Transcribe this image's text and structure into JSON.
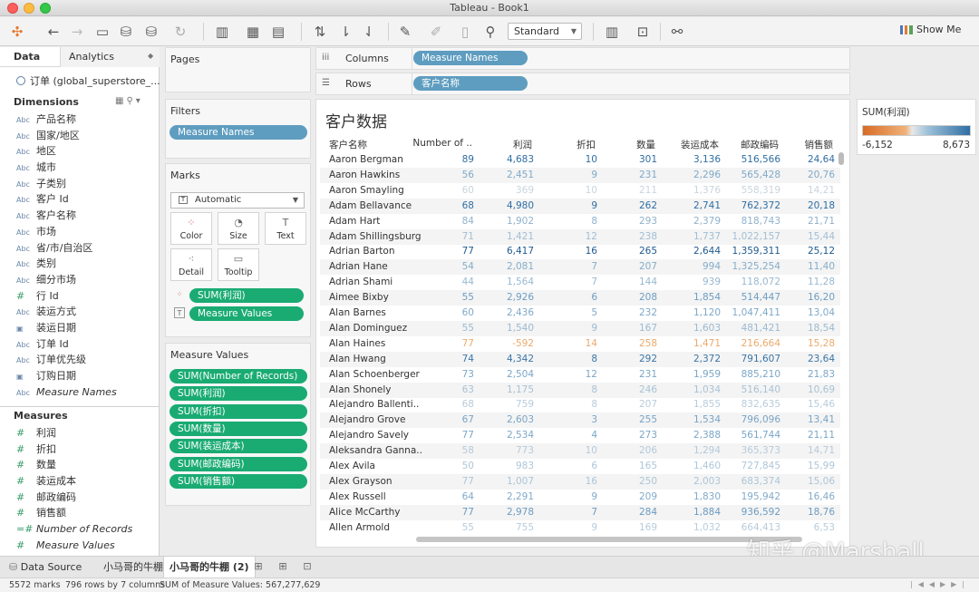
{
  "window": {
    "title": "Tableau - Book1"
  },
  "toolbar": {
    "icons": [
      "tableau-logo-icon",
      "back-icon",
      "forward-icon",
      "save-icon",
      "new-datasource-icon",
      "datasource-icon",
      "refresh-icon",
      "new-sheet-icon",
      "duplicate-sheet-icon",
      "clear-sheet-icon",
      "swap-icon",
      "sort-asc-icon",
      "sort-desc-icon",
      "highlight-icon",
      "annotate-icon",
      "fit-icon",
      "pin-icon",
      "chart-size-icon",
      "presentation-icon",
      "share-icon"
    ],
    "fit_select": "Standard",
    "show_me": "Show Me"
  },
  "left_pane": {
    "tab_data": "Data",
    "tab_analytics": "Analytics",
    "datasource": "订单 (global_superstore_...",
    "dimensions_title": "Dimensions",
    "dimensions": [
      {
        "type": "Abc",
        "name": "产品名称"
      },
      {
        "type": "Abc",
        "name": "国家/地区"
      },
      {
        "type": "Abc",
        "name": "地区"
      },
      {
        "type": "Abc",
        "name": "城市"
      },
      {
        "type": "Abc",
        "name": "子类别"
      },
      {
        "type": "Abc",
        "name": "客户 Id"
      },
      {
        "type": "Abc",
        "name": "客户名称"
      },
      {
        "type": "Abc",
        "name": "市场"
      },
      {
        "type": "Abc",
        "name": "省/市/自治区"
      },
      {
        "type": "Abc",
        "name": "类别"
      },
      {
        "type": "Abc",
        "name": "细分市场"
      },
      {
        "type": "#",
        "name": "行 Id"
      },
      {
        "type": "Abc",
        "name": "装运方式"
      },
      {
        "type": "▣",
        "name": "装运日期"
      },
      {
        "type": "Abc",
        "name": "订单 Id"
      },
      {
        "type": "Abc",
        "name": "订单优先级"
      },
      {
        "type": "▣",
        "name": "订购日期"
      },
      {
        "type": "Abc",
        "name": "Measure Names"
      }
    ],
    "measures_title": "Measures",
    "measures": [
      {
        "type": "#",
        "name": "利润"
      },
      {
        "type": "#",
        "name": "折扣"
      },
      {
        "type": "#",
        "name": "数量"
      },
      {
        "type": "#",
        "name": "装运成本"
      },
      {
        "type": "#",
        "name": "邮政编码"
      },
      {
        "type": "#",
        "name": "销售额"
      },
      {
        "type": "=#",
        "name": "Number of Records"
      },
      {
        "type": "#",
        "name": "Measure Values"
      }
    ]
  },
  "pages": {
    "title": "Pages"
  },
  "filters": {
    "title": "Filters",
    "pills": [
      "Measure Names"
    ]
  },
  "marks": {
    "title": "Marks",
    "type": "Automatic",
    "buttons": [
      {
        "label": "Color",
        "icon": "⁘"
      },
      {
        "label": "Size",
        "icon": "◔"
      },
      {
        "label": "Text",
        "icon": "T"
      },
      {
        "label": "Detail",
        "icon": "⁖"
      },
      {
        "label": "Tooltip",
        "icon": "▭"
      }
    ],
    "pills": [
      {
        "icon": "⁘",
        "label": "SUM(利润)"
      },
      {
        "icon": "T",
        "label": "Measure Values"
      }
    ]
  },
  "measure_values": {
    "title": "Measure Values",
    "pills": [
      "SUM(Number of Records)",
      "SUM(利润)",
      "SUM(折扣)",
      "SUM(数量)",
      "SUM(装运成本)",
      "SUM(邮政编码)",
      "SUM(销售额)"
    ]
  },
  "columns_shelf": {
    "label": "Columns",
    "pill": "Measure Names"
  },
  "rows_shelf": {
    "label": "Rows",
    "pill": "客户名称"
  },
  "view": {
    "title": "客户数据",
    "headers": [
      "客户名称",
      "Number of ..",
      "利润",
      "折扣",
      "数量",
      "装运成本",
      "邮政编码",
      "销售额"
    ],
    "rows": [
      {
        "name": "Aaron Bergman",
        "vals": [
          "89",
          "4,683",
          "10",
          "301",
          "3,136",
          "516,566",
          "24,64"
        ],
        "tone": "#2f6ea3"
      },
      {
        "name": "Aaron Hawkins",
        "vals": [
          "56",
          "2,451",
          "9",
          "231",
          "2,296",
          "565,428",
          "20,76"
        ],
        "tone": "#7fa9c8"
      },
      {
        "name": "Aaron Smayling",
        "vals": [
          "60",
          "369",
          "10",
          "211",
          "1,376",
          "558,319",
          "14,21"
        ],
        "tone": "#c9d5de"
      },
      {
        "name": "Adam Bellavance",
        "vals": [
          "68",
          "4,980",
          "9",
          "262",
          "2,741",
          "762,372",
          "20,18"
        ],
        "tone": "#2f6ea3"
      },
      {
        "name": "Adam Hart",
        "vals": [
          "84",
          "1,902",
          "8",
          "293",
          "2,379",
          "818,743",
          "21,71"
        ],
        "tone": "#8fb2cd"
      },
      {
        "name": "Adam Shillingsburg",
        "vals": [
          "71",
          "1,421",
          "12",
          "238",
          "1,737",
          "1,022,157",
          "15,44"
        ],
        "tone": "#a2bed4"
      },
      {
        "name": "Adrian Barton",
        "vals": [
          "77",
          "6,417",
          "16",
          "265",
          "2,644",
          "1,359,311",
          "25,12"
        ],
        "tone": "#1f5a8e"
      },
      {
        "name": "Adrian Hane",
        "vals": [
          "54",
          "2,081",
          "7",
          "207",
          "994",
          "1,325,254",
          "11,40"
        ],
        "tone": "#86acc9"
      },
      {
        "name": "Adrian Shami",
        "vals": [
          "44",
          "1,564",
          "7",
          "144",
          "939",
          "118,072",
          "11,28"
        ],
        "tone": "#98b8d0"
      },
      {
        "name": "Aimee Bixby",
        "vals": [
          "55",
          "2,926",
          "6",
          "208",
          "1,854",
          "514,447",
          "16,20"
        ],
        "tone": "#6d9dc2"
      },
      {
        "name": "Alan Barnes",
        "vals": [
          "60",
          "2,436",
          "5",
          "232",
          "1,120",
          "1,047,411",
          "13,04"
        ],
        "tone": "#7fa9c8"
      },
      {
        "name": "Alan Dominguez",
        "vals": [
          "55",
          "1,540",
          "9",
          "167",
          "1,603",
          "481,421",
          "18,54"
        ],
        "tone": "#9ab9d1"
      },
      {
        "name": "Alan Haines",
        "vals": [
          "77",
          "-592",
          "14",
          "258",
          "1,471",
          "216,664",
          "15,28"
        ],
        "tone": "#eda96a"
      },
      {
        "name": "Alan Hwang",
        "vals": [
          "74",
          "4,342",
          "8",
          "292",
          "2,372",
          "791,607",
          "23,64"
        ],
        "tone": "#3a76a8"
      },
      {
        "name": "Alan Schoenberger",
        "vals": [
          "73",
          "2,504",
          "12",
          "231",
          "1,959",
          "885,210",
          "21,83"
        ],
        "tone": "#7ca7c7"
      },
      {
        "name": "Alan Shonely",
        "vals": [
          "63",
          "1,175",
          "8",
          "246",
          "1,034",
          "516,140",
          "10,69"
        ],
        "tone": "#a8c2d6"
      },
      {
        "name": "Alejandro Ballenti..",
        "vals": [
          "68",
          "759",
          "8",
          "207",
          "1,855",
          "832,635",
          "15,46"
        ],
        "tone": "#b8ccdb"
      },
      {
        "name": "Alejandro Grove",
        "vals": [
          "67",
          "2,603",
          "3",
          "255",
          "1,534",
          "796,096",
          "13,41"
        ],
        "tone": "#78a4c6"
      },
      {
        "name": "Alejandro Savely",
        "vals": [
          "77",
          "2,534",
          "4",
          "273",
          "2,388",
          "561,744",
          "21,11"
        ],
        "tone": "#7aa6c7"
      },
      {
        "name": "Aleksandra Ganna..",
        "vals": [
          "58",
          "773",
          "10",
          "206",
          "1,294",
          "365,373",
          "14,71"
        ],
        "tone": "#b6cadb"
      },
      {
        "name": "Alex Avila",
        "vals": [
          "50",
          "983",
          "6",
          "165",
          "1,460",
          "727,845",
          "15,99"
        ],
        "tone": "#afc6d8"
      },
      {
        "name": "Alex Grayson",
        "vals": [
          "77",
          "1,007",
          "16",
          "250",
          "2,003",
          "683,374",
          "15,06"
        ],
        "tone": "#adc5d7"
      },
      {
        "name": "Alex Russell",
        "vals": [
          "64",
          "2,291",
          "9",
          "209",
          "1,830",
          "195,942",
          "16,46"
        ],
        "tone": "#82aac9"
      },
      {
        "name": "Alice McCarthy",
        "vals": [
          "77",
          "2,978",
          "7",
          "284",
          "1,884",
          "936,592",
          "18,76"
        ],
        "tone": "#6b9bc1"
      },
      {
        "name": "Allen Armold",
        "vals": [
          "55",
          "755",
          "9",
          "169",
          "1,032",
          "664,413",
          "6,53"
        ],
        "tone": "#b8ccdb"
      }
    ]
  },
  "legend": {
    "title": "SUM(利润)",
    "min": "-6,152",
    "max": "8,673"
  },
  "watermark": "知乎 @Marshall",
  "sheet_tabs": {
    "datasource": "Data Source",
    "tabs": [
      "小马哥的牛棚",
      "小马哥的牛棚 (2)"
    ]
  },
  "status": {
    "marks": "5572 marks",
    "rows_cols": "796 rows by 7 columns",
    "sum": "SUM of Measure Values: 567,277,629"
  }
}
